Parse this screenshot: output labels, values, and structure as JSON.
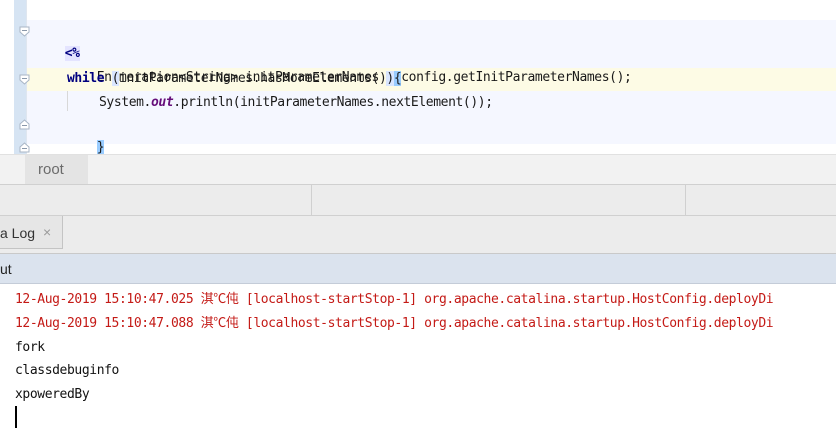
{
  "editor": {
    "lines": {
      "open_tag": "<%",
      "line1": {
        "text": "Enumeration<String> initParameterNames = config.getInitParameterNames();"
      },
      "line2": {
        "keyword": "while",
        "space": " ",
        "paren_open": "(",
        "condition": "initParameterNames.hasMoreElements()",
        "paren_close": ")",
        "brace_open": "{"
      },
      "line3": {
        "prefix": "System.",
        "field": "out",
        "suffix": ".println(initParameterNames.nextElement());"
      },
      "line4": {
        "brace_close": "}"
      },
      "close_tag": "%>"
    }
  },
  "breadcrumb": {
    "item": "root"
  },
  "tabs": {
    "log_tab": {
      "label": "a Log",
      "close": "×"
    }
  },
  "output": {
    "header_label": "ut",
    "console_lines": [
      {
        "kind": "err",
        "text": "12-Aug-2019 15:10:47.025 淇℃伅 [localhost-startStop-1] org.apache.catalina.startup.HostConfig.deployDi"
      },
      {
        "kind": "err",
        "text": "12-Aug-2019 15:10:47.088 淇℃伅 [localhost-startStop-1] org.apache.catalina.startup.HostConfig.deployDi"
      },
      {
        "kind": "out",
        "text": "fork"
      },
      {
        "kind": "out",
        "text": "classdebuginfo"
      },
      {
        "kind": "out",
        "text": "xpoweredBy"
      }
    ]
  },
  "colors": {
    "keyword": "#000080",
    "static_field": "#660e7a",
    "console_error": "#c41a16",
    "current_line": "#fdfbe5",
    "brace_highlight": "#99ccff"
  },
  "icons": [
    "fold-open-icon",
    "fold-close-icon",
    "close-icon"
  ]
}
